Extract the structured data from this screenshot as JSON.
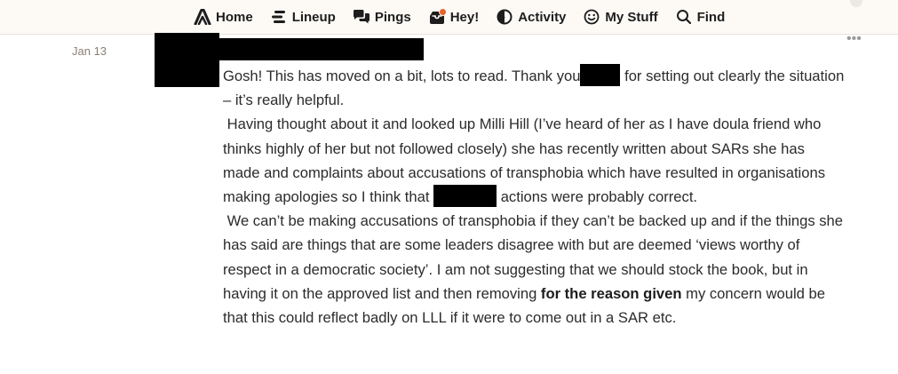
{
  "nav": {
    "items": [
      {
        "label": "Home",
        "icon": "home-icon"
      },
      {
        "label": "Lineup",
        "icon": "lineup-icon"
      },
      {
        "label": "Pings",
        "icon": "pings-icon"
      },
      {
        "label": "Hey!",
        "icon": "hey-icon",
        "has_notification": true
      },
      {
        "label": "Activity",
        "icon": "activity-icon"
      },
      {
        "label": "My Stuff",
        "icon": "smiley-icon"
      },
      {
        "label": "Find",
        "icon": "search-icon"
      }
    ]
  },
  "message": {
    "date": "Jan 13",
    "more_label": "•••",
    "p1_a": "Gosh! This has moved on a bit, lots to read. Thank you",
    "p1_b": " for setting out clearly the situation – it’s really helpful.",
    "p2_a": " Having thought about it and looked up Milli Hill (I’ve heard of her as I have doula friend who thinks highly of her but not followed closely) she has recently written about SARs she has made and complaints about accusations of transphobia which have resulted in organisations making apologies so I think that",
    "p2_b": " actions were probably correct.",
    "p3_a": " We can’t be making accusations of transphobia if they can’t be backed up and if the things she has said are things that are some leaders disagree with but are deemed ‘views worthy of respect in a democratic society’. I am not suggesting that we should stock the book, but in having it on the approved list and then removing ",
    "p3_bold": "for the reason given",
    "p3_c": " my concern would be that this could reflect badly on LLL if it were to come out in a SAR etc."
  },
  "colors": {
    "nav_bg": "#fdfaf6",
    "date_text": "#8a7f70",
    "notification_dot": "#e8622d",
    "redaction": "#000000"
  }
}
